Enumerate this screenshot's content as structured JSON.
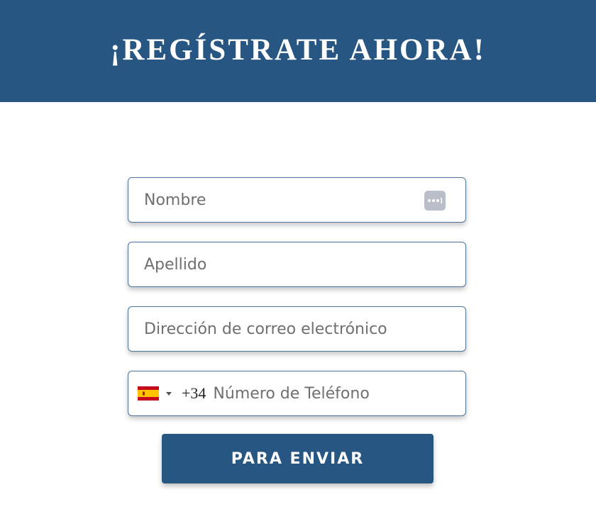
{
  "header": {
    "title": "¡REGÍSTRATE AHORA!"
  },
  "form": {
    "first_name": {
      "placeholder": "Nombre",
      "value": ""
    },
    "last_name": {
      "placeholder": "Apellido",
      "value": ""
    },
    "email": {
      "placeholder": "Dirección de correo electrónico",
      "value": ""
    },
    "phone": {
      "country_flag": "spain-flag-icon",
      "dial_code": "+34",
      "placeholder": "Número de Teléfono",
      "value": ""
    },
    "submit_label": "PARA ENVIAR"
  },
  "colors": {
    "brand": "#275683",
    "field_border": "#4b74a3",
    "autofill_icon": "#b9bec9"
  },
  "icons": {
    "autofill": "password-dots-icon",
    "dropdown": "caret-down-icon"
  }
}
